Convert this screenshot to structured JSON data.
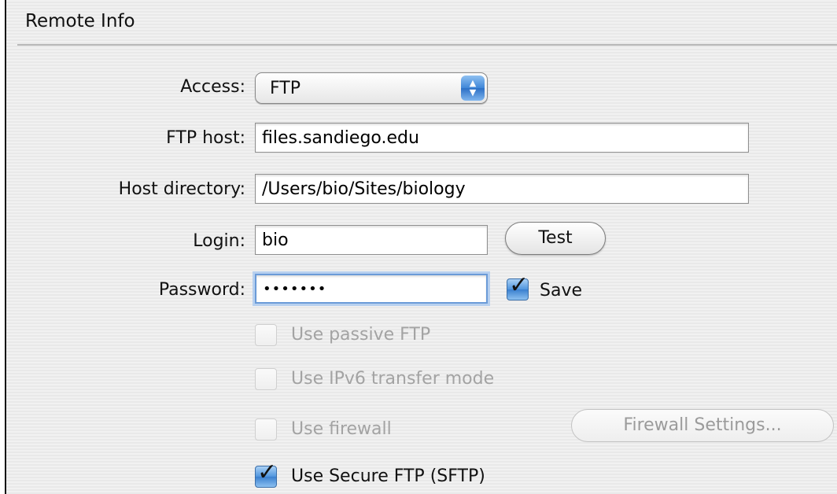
{
  "section": {
    "title": "Remote Info"
  },
  "access": {
    "label": "Access:",
    "value": "FTP"
  },
  "ftp_host": {
    "label": "FTP host:",
    "value": "files.sandiego.edu"
  },
  "host_directory": {
    "label": "Host directory:",
    "value": "/Users/bio/Sites/biology"
  },
  "login": {
    "label": "Login:",
    "value": "bio"
  },
  "test_button": {
    "label": "Test"
  },
  "password": {
    "label": "Password:",
    "value": "•••••••"
  },
  "save_password": {
    "label": "Save",
    "checked": true
  },
  "options": {
    "passive_ftp": {
      "label": "Use passive FTP",
      "checked": false,
      "enabled": false
    },
    "ipv6": {
      "label": "Use IPv6 transfer mode",
      "checked": false,
      "enabled": false
    },
    "firewall": {
      "label": "Use firewall",
      "checked": false,
      "enabled": false
    },
    "firewall_settings_button": {
      "label": "Firewall Settings...",
      "enabled": false
    },
    "sftp": {
      "label": "Use Secure FTP (SFTP)",
      "checked": true,
      "enabled": true
    }
  },
  "colors": {
    "accent": "#3f86d8",
    "focus_ring": "#b7d0ef",
    "disabled_text": "#a3a3a3"
  },
  "icons": {
    "popup_arrows": "up-down-arrows-icon",
    "checkmark": "checkmark-icon"
  }
}
